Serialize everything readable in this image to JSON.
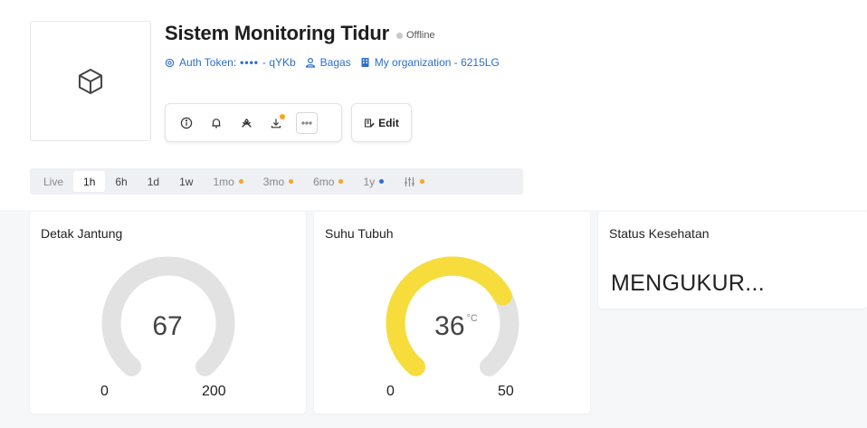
{
  "device": {
    "title": "Sistem Monitoring Tidur",
    "status": "Offline",
    "icon": "cube-icon"
  },
  "meta": {
    "auth_token_label": "Auth Token:",
    "auth_token_dots": "••••",
    "auth_token_suffix": "- qYKb",
    "owner": "Bagas",
    "organization": "My organization - 6215LG"
  },
  "toolbar": {
    "edit_label": "Edit",
    "icons": [
      "info-icon",
      "bell-icon",
      "wrench-icon",
      "download-icon",
      "more-icon"
    ]
  },
  "time_ranges": [
    {
      "label": "Live"
    },
    {
      "label": "1h"
    },
    {
      "label": "6h"
    },
    {
      "label": "1d"
    },
    {
      "label": "1w"
    },
    {
      "label": "1mo"
    },
    {
      "label": "3mo"
    },
    {
      "label": "6mo"
    },
    {
      "label": "1y"
    }
  ],
  "widgets": {
    "heart": {
      "title": "Detak Jantung",
      "value": 67,
      "value_text": "67",
      "min": 0,
      "max": 200,
      "min_text": "0",
      "max_text": "200",
      "color": "#e2e2e2"
    },
    "temp": {
      "title": "Suhu Tubuh",
      "value": 36,
      "value_text": "36",
      "unit": "°C",
      "min": 0,
      "max": 50,
      "min_text": "0",
      "max_text": "50",
      "color": "#f6dd3c"
    },
    "health": {
      "title": "Status Kesehatan",
      "value": "MENGUKUR..."
    }
  },
  "colors": {
    "accent": "#2d6ecb",
    "dot_orange": "#f5a623",
    "gauge_track": "#e2e2e2",
    "gauge_fill_temp": "#f6dd3c"
  }
}
